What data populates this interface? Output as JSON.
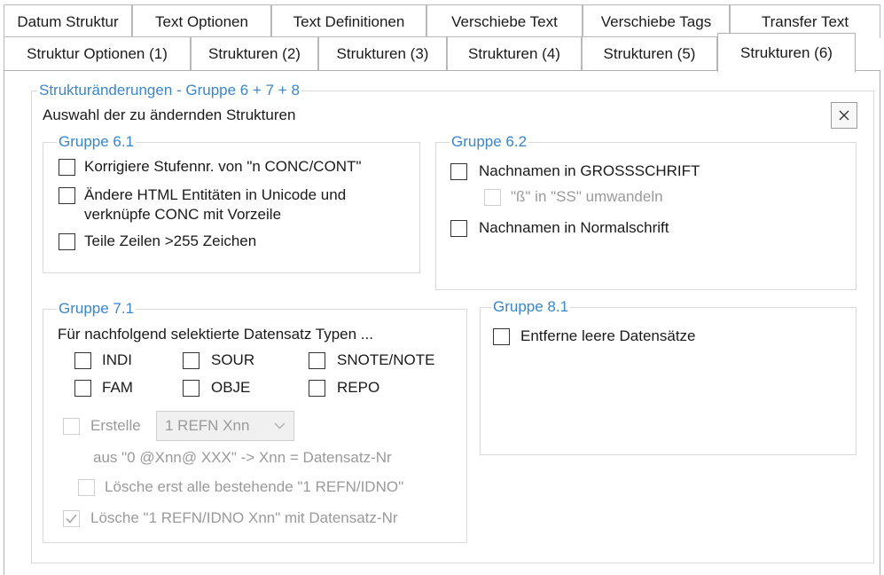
{
  "tabs_row1": [
    {
      "label": "Datum Struktur"
    },
    {
      "label": "Text Optionen"
    },
    {
      "label": "Text Definitionen"
    },
    {
      "label": "Verschiebe Text"
    },
    {
      "label": "Verschiebe Tags"
    },
    {
      "label": "Transfer Text"
    }
  ],
  "tabs_row2": [
    {
      "label": "Struktur Optionen (1)"
    },
    {
      "label": "Strukturen (2)"
    },
    {
      "label": "Strukturen (3)"
    },
    {
      "label": "Strukturen (4)"
    },
    {
      "label": "Strukturen (5)"
    },
    {
      "label": "Strukturen (6)",
      "active": true
    }
  ],
  "main": {
    "group_title": "Strukturänderungen - Gruppe 6 + 7 + 8",
    "subtitle": "Auswahl der zu ändernden Strukturen",
    "close_label": "×"
  },
  "group61": {
    "title": "Gruppe 6.1",
    "opt1": "Korrigiere Stufennr. von \"n CONC/CONT\"",
    "opt2_line1": "Ändere HTML Entitäten in Unicode und",
    "opt2_line2": "verknüpfe CONC mit Vorzeile",
    "opt3": "Teile Zeilen >255 Zeichen"
  },
  "group62": {
    "title": "Gruppe 6.2",
    "opt1": "Nachnamen in GROSSSCHRIFT",
    "opt1_sub": "\"ß\" in \"SS\" umwandeln",
    "opt2": "Nachnamen in Normalschrift"
  },
  "group71": {
    "title": "Gruppe 7.1",
    "intro": "Für nachfolgend selektierte Datensatz Typen ...",
    "types": {
      "indi": "INDI",
      "sour": "SOUR",
      "snote": "SNOTE/NOTE",
      "fam": "FAM",
      "obje": "OBJE",
      "repo": "REPO"
    },
    "erstelle_label": "Erstelle",
    "combo_value": "1 REFN Xnn",
    "aus_text": "aus \"0 @Xnn@ XXX\"  -> Xnn = Datensatz-Nr",
    "loesche_all": "Lösche erst alle bestehende \"1 REFN/IDNO\"",
    "loesche_nr": "Lösche \"1 REFN/IDNO Xnn\" mit Datensatz-Nr",
    "loesche_nr_checked": true
  },
  "group81": {
    "title": "Gruppe 8.1",
    "opt1": "Entferne leere Datensätze"
  },
  "colors": {
    "legend": "#3a86c8",
    "disabled_text": "#9a9a9a",
    "border": "#d9d9d9"
  }
}
